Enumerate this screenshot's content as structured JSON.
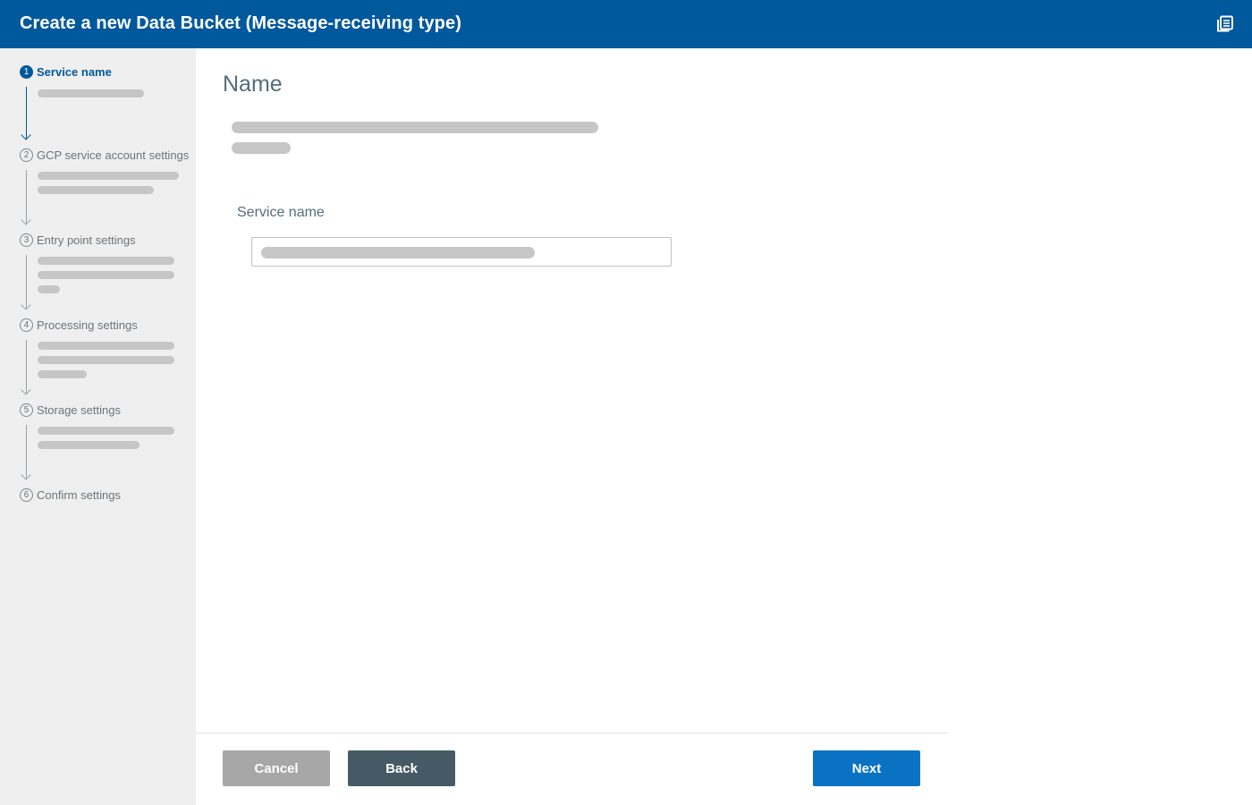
{
  "header": {
    "title": "Create a new Data Bucket (Message-receiving type)",
    "right_icon": "docs-stack-icon"
  },
  "sidebar": {
    "steps": [
      {
        "number": "1",
        "label": "Service name",
        "active": true
      },
      {
        "number": "2",
        "label": "GCP service account settings",
        "active": false
      },
      {
        "number": "3",
        "label": "Entry point settings",
        "active": false
      },
      {
        "number": "4",
        "label": "Processing settings",
        "active": false
      },
      {
        "number": "5",
        "label": "Storage settings",
        "active": false
      },
      {
        "number": "6",
        "label": "Confirm settings",
        "active": false
      }
    ]
  },
  "main": {
    "section_title": "Name",
    "field_label": "Service name"
  },
  "footer": {
    "cancel_label": "Cancel",
    "back_label": "Back",
    "next_label": "Next"
  },
  "colors": {
    "header_bg": "#00589d",
    "sidebar_bg": "#efefef",
    "active_step": "#00589d",
    "next_button": "#0a72c3",
    "back_button": "#455a64",
    "cancel_button": "#a7a7a7"
  }
}
